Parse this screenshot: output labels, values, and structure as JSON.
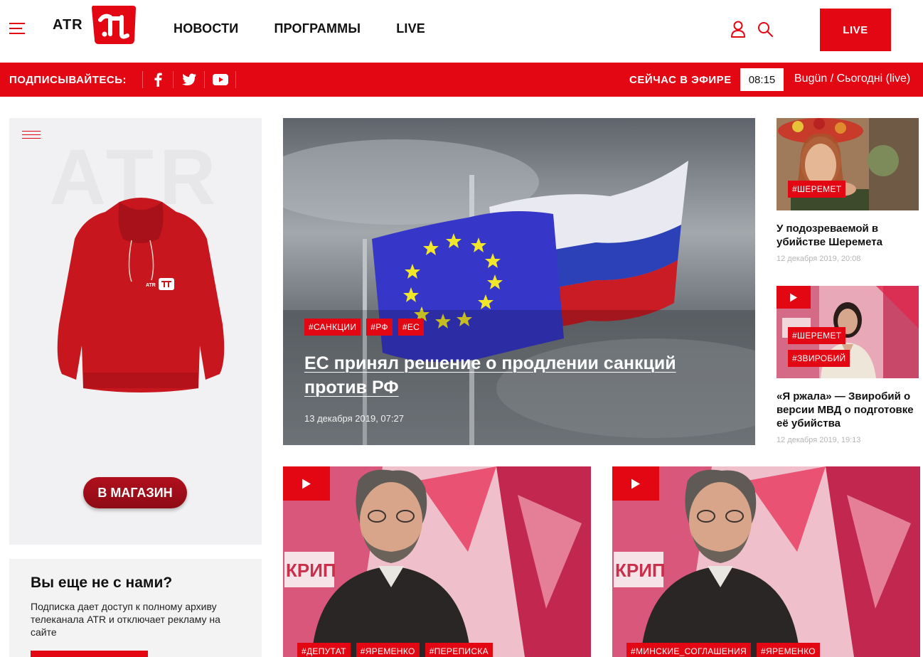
{
  "header": {
    "logo_text": "ATR",
    "nav": [
      "НОВОСТИ",
      "ПРОГРАММЫ",
      "LIVE"
    ],
    "live_button": "LIVE"
  },
  "redbar": {
    "subscribe_label": "ПОДПИСЫВАЙТЕСЬ:",
    "social": [
      "facebook",
      "twitter",
      "youtube"
    ],
    "onair_label": "СЕЙЧАС В ЭФИРЕ",
    "onair_time": "08:15",
    "onair_show": "Bugün / Сьогодні (live)"
  },
  "promo": {
    "watermark": "ATR",
    "shop_button": "В МАГАЗИН"
  },
  "subscribe_box": {
    "title": "Вы еще не с нами?",
    "text": "Подписка дает доступ к полному архиву телеканала ATR и отключает рекламу на сайте"
  },
  "hero": {
    "tags": [
      "#САНКЦИИ",
      "#РФ",
      "#ЕС"
    ],
    "title": "ЕС принял решение о продлении санкций против РФ",
    "date": "13 декабря 2019, 07:27"
  },
  "side_news": [
    {
      "tags": [
        "#ШЕРЕМЕТ"
      ],
      "title": "У подозреваемой в убийстве Шеремета",
      "date": "12 декабря 2019, 20:08",
      "video": false
    },
    {
      "tags": [
        "#ШЕРЕМЕТ",
        "#ЗВИРОБИЙ"
      ],
      "title": "«Я ржала» — Звиробий о версии МВД о подготовке её убийства",
      "date": "12 декабря 2019, 19:13",
      "video": true
    }
  ],
  "video_cards": [
    {
      "tags": [
        "#ДЕПУТАТ",
        "#ЯРЕМЕНКО",
        "#ПЕРЕПИСКА"
      ]
    },
    {
      "tags": [
        "#МИНСКИЕ_СОГЛАШЕНИЯ",
        "#ЯРЕМЕНКО"
      ]
    }
  ],
  "colors": {
    "accent": "#e30613",
    "promo_bg": "#f1f1f3",
    "date_grey": "#b5b5b5"
  }
}
